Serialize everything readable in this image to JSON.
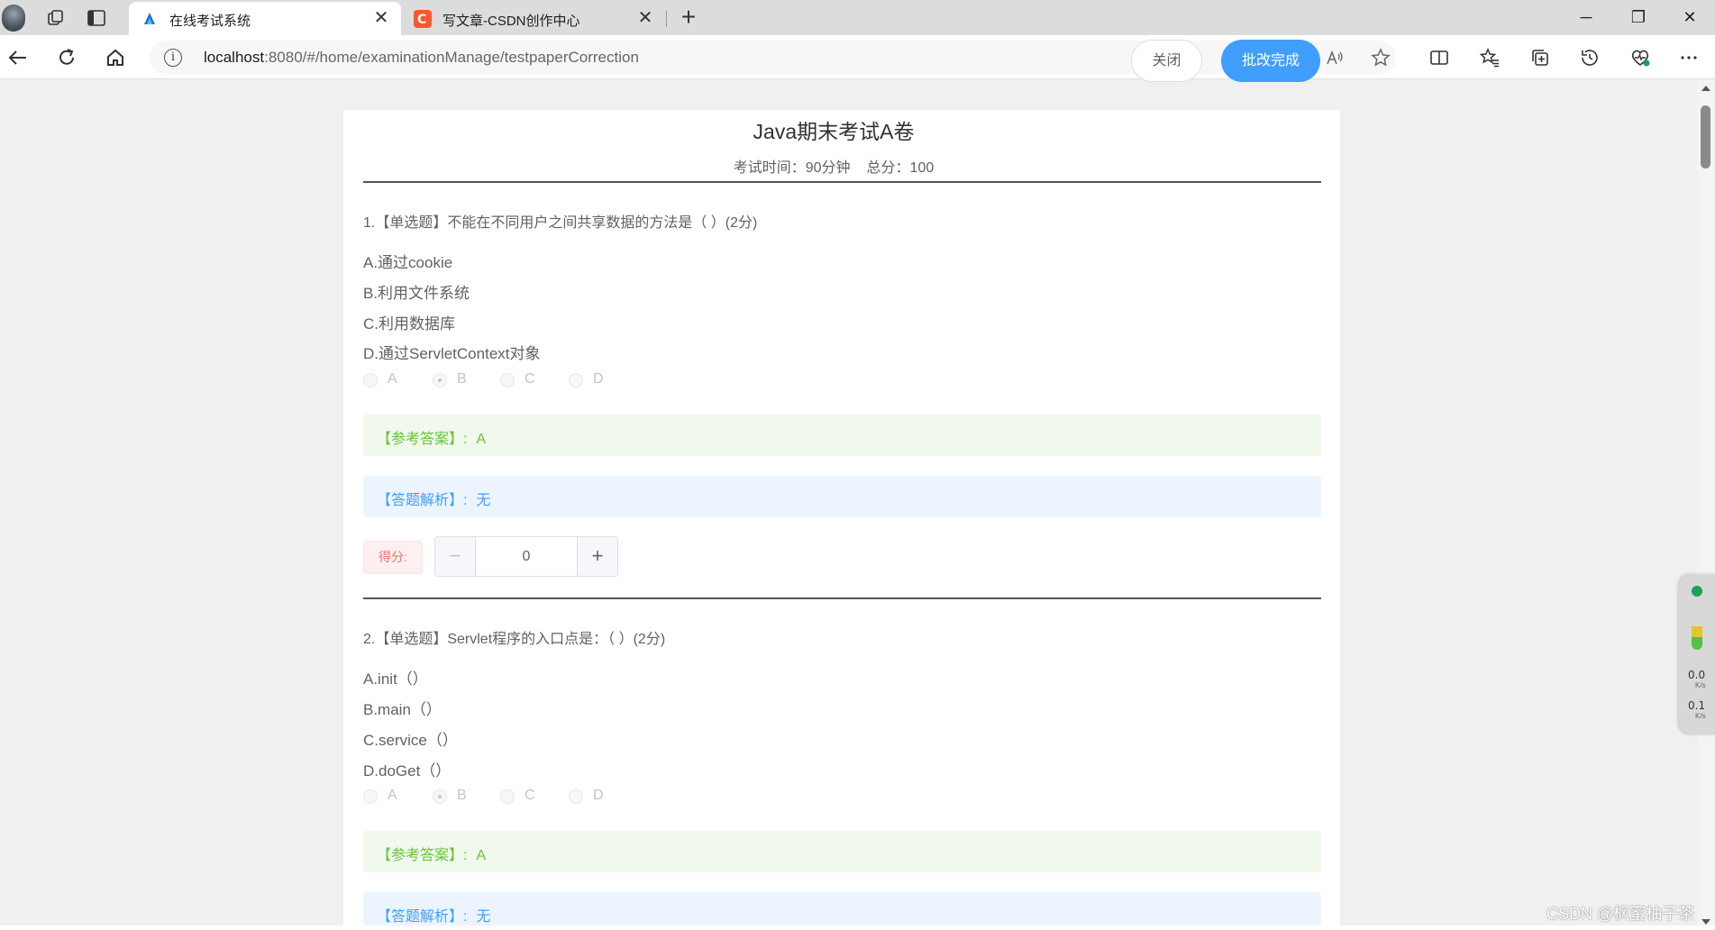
{
  "browser": {
    "tabs": [
      {
        "title": "在线考试系统",
        "active": true,
        "favicon": "exam-system-icon"
      },
      {
        "title": "写文章-CSDN创作中心",
        "active": false,
        "favicon": "csdn-icon"
      }
    ],
    "address": {
      "host": "localhost",
      "rest": ":8080/#/home/examinationManage/testpaperCorrection"
    },
    "window_controls": {
      "minimize": "─",
      "restore": "❐",
      "close": "✕"
    }
  },
  "exam": {
    "title": "Java期末考试A卷",
    "time_label": "考试时间：90分钟",
    "score_label": "总分：100",
    "close_button": "关闭",
    "done_button": "批改完成"
  },
  "questions": [
    {
      "title": "1.【单选题】不能在不同用户之间共享数据的方法是（ ）(2分)",
      "options": [
        "A.通过cookie",
        "B.利用文件系统",
        "C.利用数据库",
        "D.通过ServletContext对象"
      ],
      "choices": [
        "A",
        "B",
        "C",
        "D"
      ],
      "selected": "B",
      "answer_label": "【参考答案】:",
      "answer_value": "A",
      "analysis_label": "【答题解析】:",
      "analysis_value": "无",
      "score_label": "得分:",
      "score_value": "0",
      "minus": "−",
      "plus": "+"
    },
    {
      "title": "2.【单选题】Servlet程序的入口点是：（ ）(2分)",
      "options": [
        "A.init（）",
        "B.main（）",
        "C.service（）",
        "D.doGet（）"
      ],
      "choices": [
        "A",
        "B",
        "C",
        "D"
      ],
      "selected": "B",
      "answer_label": "【参考答案】:",
      "answer_value": "A",
      "analysis_label": "【答题解析】:",
      "analysis_value": "无"
    }
  ],
  "net_widget": {
    "upload": "0.0",
    "download": "0.1",
    "unit": "K/s"
  },
  "watermark": "CSDN @枫蜜柚子茶"
}
